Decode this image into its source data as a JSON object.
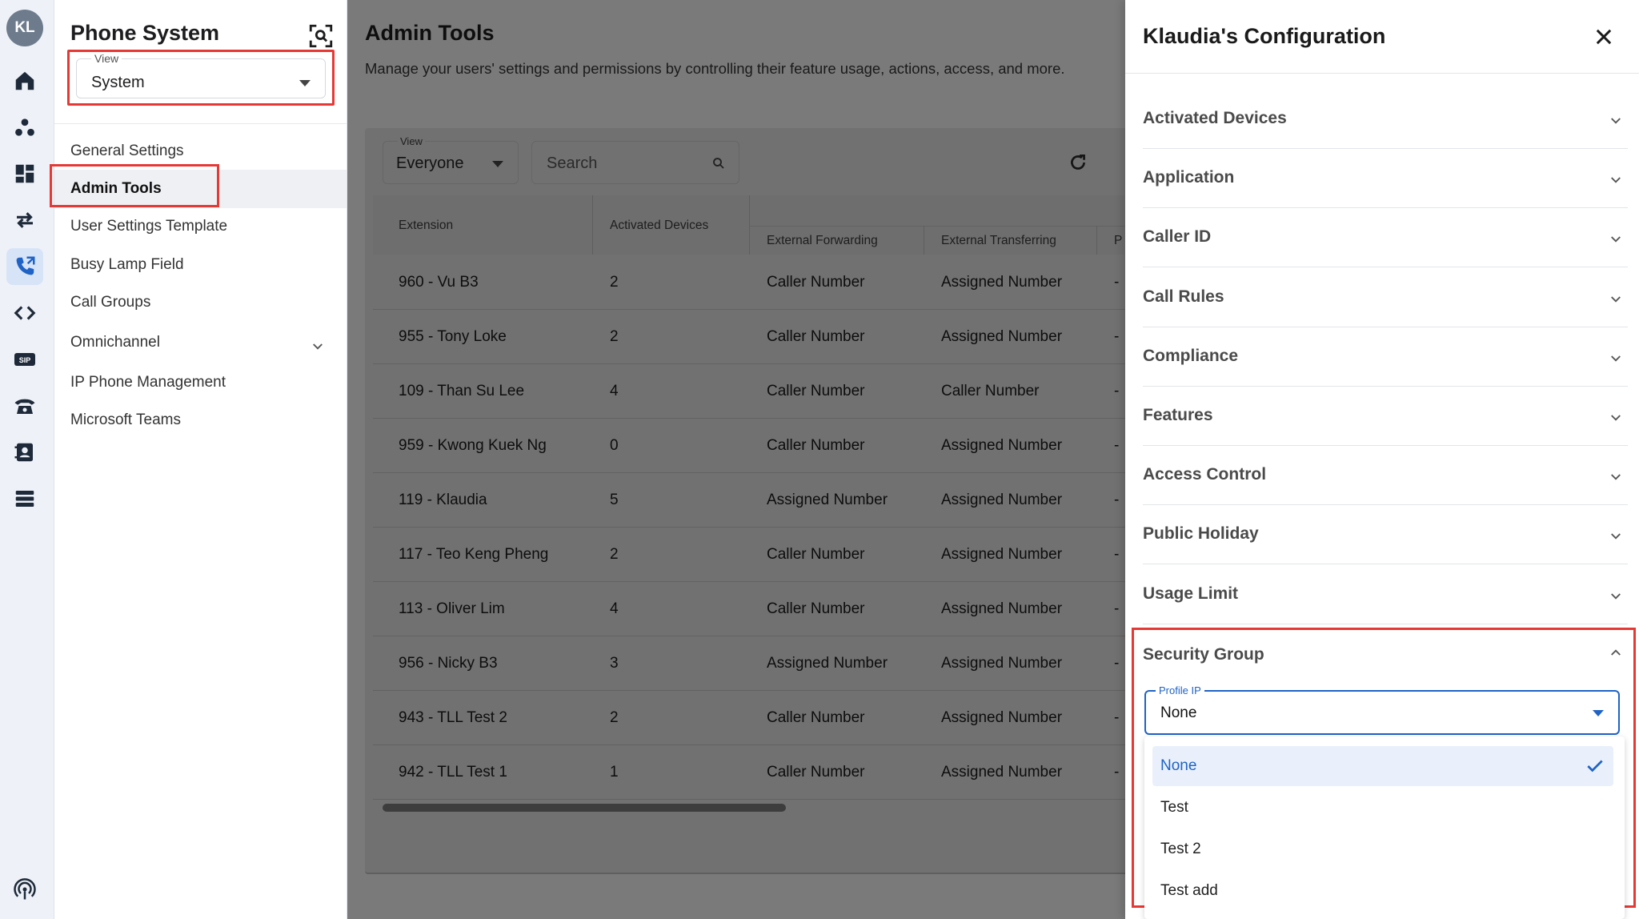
{
  "rail": {
    "avatar_initials": "KL",
    "icons": [
      "home-icon",
      "network-icon",
      "dashboard-icon",
      "transfer-arrows-icon",
      "phone-icon",
      "code-icon",
      "sip-icon",
      "desk-phone-icon",
      "contacts-icon",
      "server-icon",
      "broadcast-icon"
    ],
    "sip_label": "SIP",
    "active_icon": "phone-icon"
  },
  "sidebar": {
    "title": "Phone System",
    "view": {
      "label": "View",
      "value": "System"
    },
    "items": [
      {
        "label": "General Settings"
      },
      {
        "label": "Admin Tools"
      },
      {
        "label": "User Settings Template"
      },
      {
        "label": "Busy Lamp Field"
      },
      {
        "label": "Call Groups"
      },
      {
        "label": "Omnichannel"
      },
      {
        "label": "IP Phone Management"
      },
      {
        "label": "Microsoft Teams"
      }
    ],
    "active_item": "Admin Tools"
  },
  "main": {
    "title": "Admin Tools",
    "description": "Manage your users' settings and permissions by controlling their feature usage, actions, access, and more.",
    "filter": {
      "label": "View",
      "value": "Everyone"
    },
    "search_placeholder": "Search",
    "columns": [
      "Extension",
      "Activated Devices",
      "External Forwarding",
      "External Transferring",
      "P"
    ],
    "rows": [
      {
        "extension": "960 - Vu B3",
        "devices": "2",
        "forwarding": "Caller Number",
        "transferring": "Assigned Number",
        "more": "-"
      },
      {
        "extension": "955 - Tony Loke",
        "devices": "2",
        "forwarding": "Caller Number",
        "transferring": "Assigned Number",
        "more": "-"
      },
      {
        "extension": "109 - Than Su Lee",
        "devices": "4",
        "forwarding": "Caller Number",
        "transferring": "Caller Number",
        "more": "-"
      },
      {
        "extension": "959 - Kwong Kuek Ng",
        "devices": "0",
        "forwarding": "Caller Number",
        "transferring": "Assigned Number",
        "more": "-"
      },
      {
        "extension": "119 - Klaudia",
        "devices": "5",
        "forwarding": "Assigned Number",
        "transferring": "Assigned Number",
        "more": "-"
      },
      {
        "extension": "117 - Teo Keng Pheng",
        "devices": "2",
        "forwarding": "Caller Number",
        "transferring": "Assigned Number",
        "more": "-"
      },
      {
        "extension": "113 - Oliver Lim",
        "devices": "4",
        "forwarding": "Caller Number",
        "transferring": "Assigned Number",
        "more": "-"
      },
      {
        "extension": "956 - Nicky B3",
        "devices": "3",
        "forwarding": "Assigned Number",
        "transferring": "Assigned Number",
        "more": "-"
      },
      {
        "extension": "943 - TLL Test 2",
        "devices": "2",
        "forwarding": "Caller Number",
        "transferring": "Assigned Number",
        "more": "-"
      },
      {
        "extension": "942 - TLL Test 1",
        "devices": "1",
        "forwarding": "Caller Number",
        "transferring": "Assigned Number",
        "more": "-"
      }
    ]
  },
  "panel": {
    "title": "Klaudia's Configuration",
    "sections": [
      {
        "label": "Activated Devices"
      },
      {
        "label": "Application"
      },
      {
        "label": "Caller ID"
      },
      {
        "label": "Call Rules"
      },
      {
        "label": "Compliance"
      },
      {
        "label": "Features"
      },
      {
        "label": "Access Control"
      },
      {
        "label": "Public Holiday"
      },
      {
        "label": "Usage Limit"
      }
    ],
    "security_group": {
      "title": "Security Group",
      "profile_ip": {
        "label": "Profile IP",
        "value": "None"
      },
      "options": [
        {
          "label": "None",
          "selected": true
        },
        {
          "label": "Test",
          "selected": false
        },
        {
          "label": "Test 2",
          "selected": false
        },
        {
          "label": "Test add",
          "selected": false
        }
      ]
    }
  },
  "colors": {
    "highlight_red": "#e53935",
    "accent_blue": "#1f63c6",
    "overlay_gray": "#7a7a7a"
  }
}
